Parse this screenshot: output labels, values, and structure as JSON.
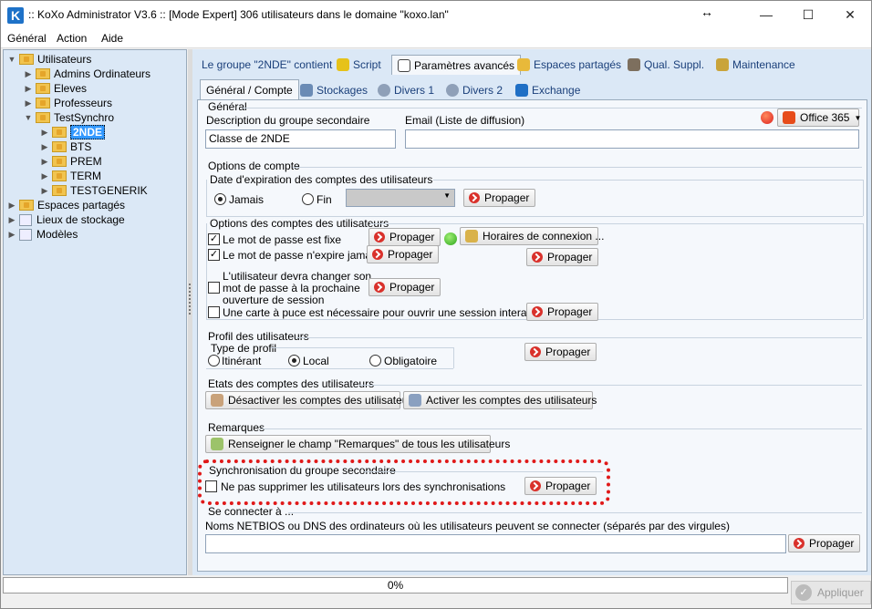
{
  "window": {
    "title": ":: KoXo Administrator V3.6 :: [Mode Expert] 306 utilisateurs dans le domaine \"koxo.lan\"",
    "logo_letter": "K",
    "minimize": "—",
    "maximize": "☐",
    "close": "✕",
    "resize_glyph": "↔"
  },
  "menu": [
    "Général",
    "Action",
    "Aide"
  ],
  "tree": {
    "root_users": "Utilisateurs",
    "admins": "Admins Ordinateurs",
    "eleves": "Eleves",
    "profs": "Professeurs",
    "testsync": "TestSynchro",
    "g2nde": "2NDE",
    "bts": "BTS",
    "prem": "PREM",
    "term": "TERM",
    "testgen": "TESTGENERIK",
    "espaces": "Espaces partagés",
    "lieux": "Lieux de stockage",
    "modeles": "Modèles"
  },
  "tabs_top": [
    "Le groupe \"2NDE\" contient",
    "Script",
    "Paramètres avancés",
    "Espaces partagés",
    "Qual. Suppl.",
    "Maintenance"
  ],
  "tabs_sub": [
    "Général / Compte",
    "Stockages",
    "Divers 1",
    "Divers 2",
    "Exchange"
  ],
  "general": {
    "heading": "Général",
    "desc_label": "Description du groupe secondaire",
    "desc_value": "Classe de 2NDE",
    "email_label": "Email (Liste de diffusion)",
    "email_value": "",
    "office_label": "Office 365"
  },
  "options": {
    "heading": "Options de compte",
    "expiry_heading": "Date d'expiration des comptes des utilisateurs",
    "radio_never": "Jamais",
    "radio_end": "Fin",
    "propagate": "Propager",
    "user_opts_heading": "Options des comptes des utilisateurs",
    "pwd_fixed": "Le mot de passe est fixe",
    "pwd_never_expires": "Le mot de passe n'expire jamais",
    "change_pwd_1": "L'utilisateur devra changer son",
    "change_pwd_2": "mot de passe à la prochaine",
    "change_pwd_3": "ouverture de session",
    "smartcard": "Une carte à puce est nécessaire pour ouvrir une session interactive",
    "login_hours": "Horaires de connexion ..."
  },
  "profile": {
    "heading": "Profil des utilisateurs",
    "type_heading": "Type de profil",
    "roaming": "Itinérant",
    "local": "Local",
    "mandatory": "Obligatoire"
  },
  "states": {
    "heading": "Etats des comptes des utilisateurs",
    "disable": "Désactiver les comptes des utilisateurs",
    "enable": "Activer les comptes des utilisateurs"
  },
  "remarks": {
    "heading": "Remarques",
    "fill": "Renseigner le champ \"Remarques\" de tous les utilisateurs"
  },
  "sync": {
    "heading": "Synchronisation du groupe secondaire",
    "no_delete": "Ne pas supprimer les utilisateurs lors des synchronisations"
  },
  "connect": {
    "heading": "Se connecter à ...",
    "label": "Noms NETBIOS ou DNS des ordinateurs où les utilisateurs peuvent se connecter (séparés par des virgules)",
    "value": ""
  },
  "progress": "0%",
  "apply": "Appliquer",
  "colors": {
    "accent": "#3399ff",
    "highlight": "#e01919",
    "panel": "#dbe8f6"
  }
}
